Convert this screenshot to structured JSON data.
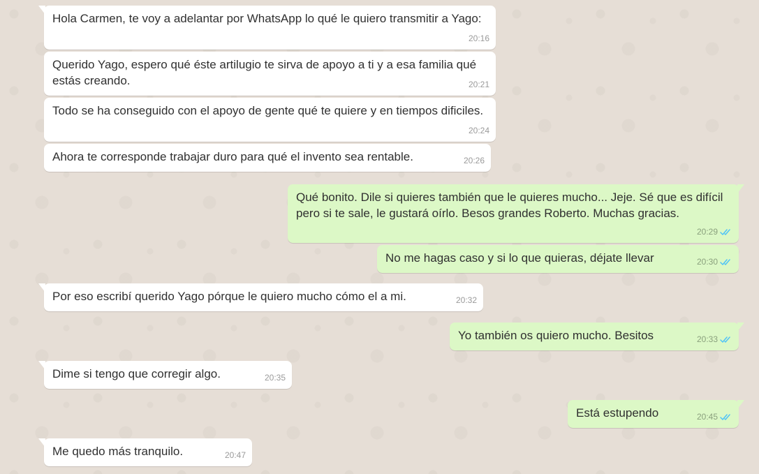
{
  "colors": {
    "chat_background": "#e6ded6",
    "incoming_bubble": "#ffffff",
    "outgoing_bubble": "#dcf8c6",
    "read_ticks": "#4fc3f7"
  },
  "messages": [
    {
      "direction": "in",
      "text": "Hola Carmen, te voy a adelantar por WhatsApp lo qué le quiero transmitir a Yago:",
      "time": "20:16"
    },
    {
      "direction": "in",
      "text": "Querido Yago, espero qué éste artilugio te sirva de apoyo a ti y a esa familia qué estás creando.",
      "time": "20:21"
    },
    {
      "direction": "in",
      "text": "Todo se ha conseguido con el apoyo de gente qué te quiere y en tiempos dificiles.",
      "time": "20:24"
    },
    {
      "direction": "in",
      "text": "Ahora te corresponde trabajar duro para qué el invento sea rentable.",
      "time": "20:26"
    },
    {
      "direction": "out",
      "text": "Qué bonito. Dile si quieres también que le quieres mucho... Jeje. Sé que es difícil pero si te sale, le gustará oírlo. Besos grandes Roberto. Muchas gracias.",
      "time": "20:29",
      "status": "read"
    },
    {
      "direction": "out",
      "text": "No me hagas caso y si lo que quieras, déjate llevar",
      "time": "20:30",
      "status": "read"
    },
    {
      "direction": "in",
      "text": "Por eso escribí querido Yago pórque le quiero mucho cómo el a mi.",
      "time": "20:32"
    },
    {
      "direction": "out",
      "text": "Yo también os quiero mucho. Besitos",
      "time": "20:33",
      "status": "read"
    },
    {
      "direction": "in",
      "text": "Dime si tengo que corregir algo.",
      "time": "20:35"
    },
    {
      "direction": "out",
      "text": "Está estupendo",
      "time": "20:45",
      "status": "read"
    },
    {
      "direction": "in",
      "text": "Me quedo más tranquilo.",
      "time": "20:47"
    }
  ]
}
